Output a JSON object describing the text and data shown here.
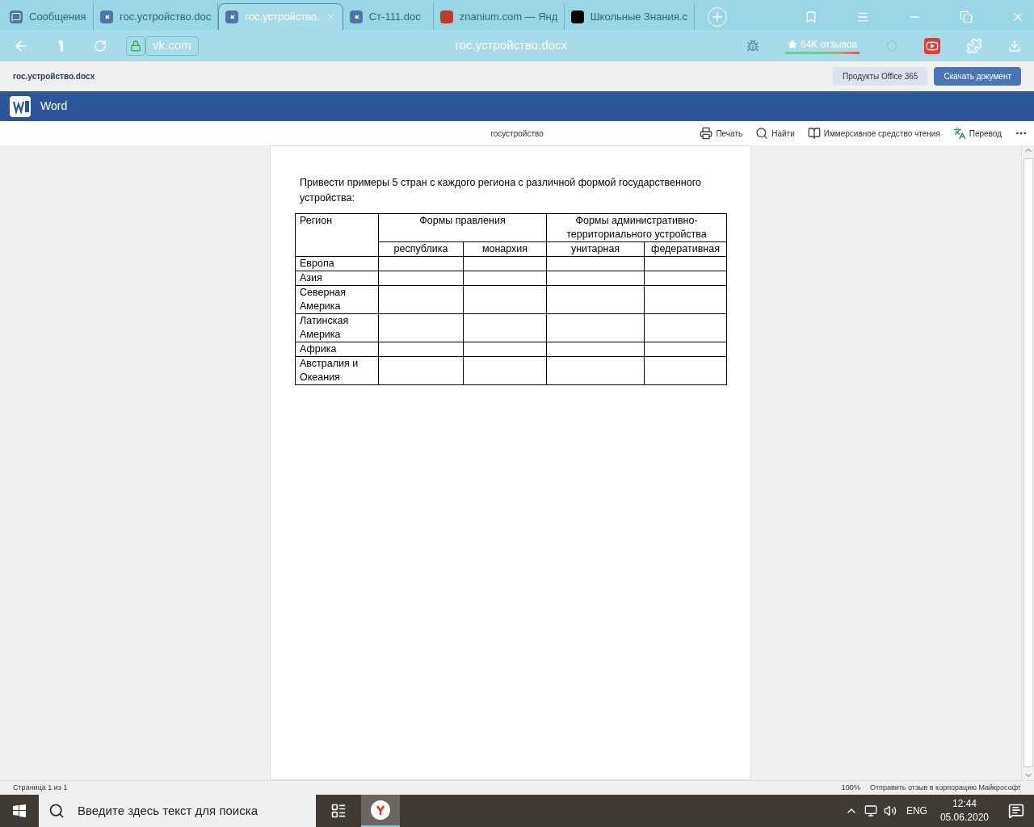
{
  "browser": {
    "tabs": [
      {
        "title": "Сообщения",
        "kind": "chat",
        "selected": false
      },
      {
        "title": "гос.устройство.doc",
        "kind": "vk",
        "selected": false
      },
      {
        "title": "гос.устройство.",
        "kind": "vk",
        "selected": true
      },
      {
        "title": "Ст-111.doc",
        "kind": "vk",
        "selected": false
      },
      {
        "title": "znanium.com — Янд",
        "kind": "znanium",
        "selected": false
      },
      {
        "title": "Школьные Знания.c",
        "kind": "znania",
        "selected": false
      }
    ],
    "address": "vk.com",
    "page_title": "гос.устройство.docx",
    "rating": "64K отзывов"
  },
  "office_bar": {
    "file_name": "гос.устройство.docx",
    "buttons": [
      {
        "label": "Продукты Office 365",
        "primary": false
      },
      {
        "label": "Скачать документ",
        "primary": true
      }
    ]
  },
  "word": {
    "app_name": "Word",
    "doc_title": "госустройство",
    "tools": [
      {
        "label": "Печать",
        "kind": "print"
      },
      {
        "label": "Найти",
        "kind": "search"
      },
      {
        "label": "Иммерсивное средство чтения",
        "kind": "reader"
      },
      {
        "label": "Перевод",
        "kind": "translate"
      }
    ]
  },
  "document": {
    "instruction": "Привести примеры 5 стран с каждого региона с различной формой государственного устройства:",
    "table": {
      "region_header": "Регион",
      "groups": [
        {
          "title": "Формы правления",
          "columns": [
            "республика",
            "монархия"
          ]
        },
        {
          "title": "Формы административно-территориального устройства",
          "columns": [
            "унитарная",
            "федеративная"
          ]
        }
      ],
      "rows": [
        "Европа",
        "Азия",
        "Северная Америка",
        "Латинская Америка",
        "Африка",
        "Австралия и Океания"
      ]
    }
  },
  "status_bar": {
    "page": "Страница 1 из 1",
    "zoom": "100%",
    "feedback": "Отправить отзыв в корпорацию Майкрософт"
  },
  "taskbar": {
    "search_placeholder": "Введите здесь текст для поиска",
    "language": "ENG",
    "time": "12:44",
    "date": "05.06.2020"
  }
}
